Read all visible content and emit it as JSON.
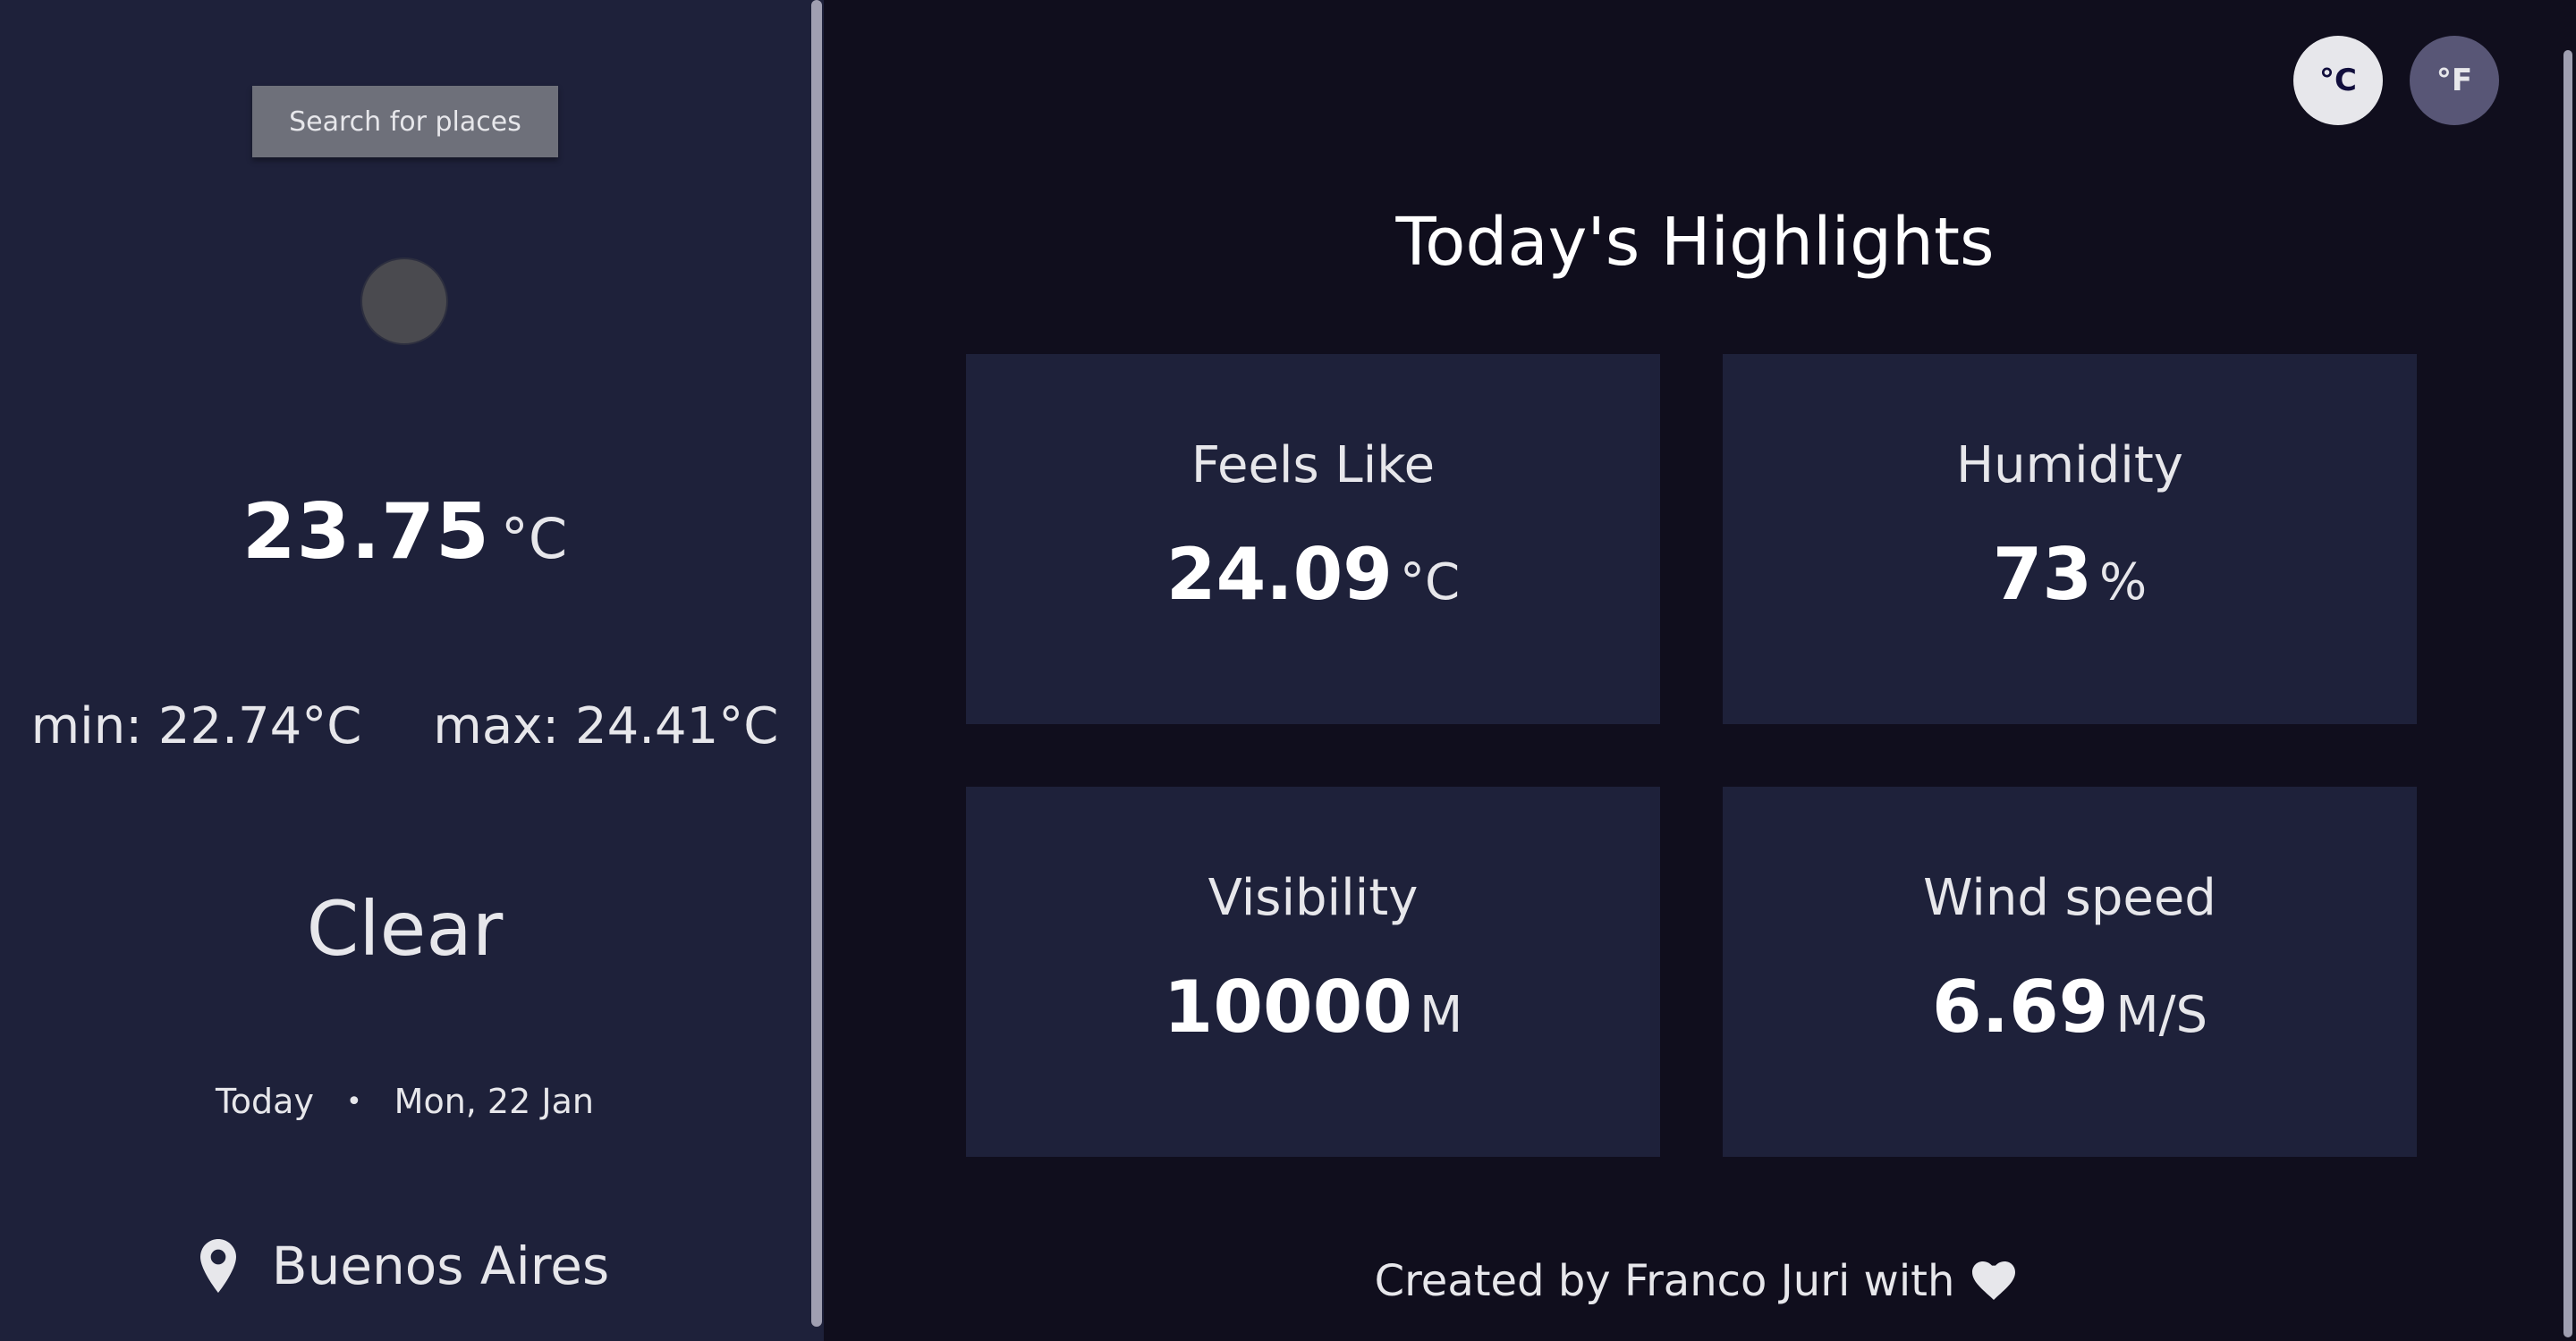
{
  "sidebar": {
    "search_label": "Search for places",
    "current": {
      "temp": "23.75",
      "unit": "°C",
      "min": "min: 22.74°C",
      "max": "max: 24.41°C",
      "condition": "Clear"
    },
    "date": {
      "today": "Today",
      "separator": "•",
      "date": "Mon, 22 Jan"
    },
    "location": "Buenos Aires"
  },
  "units": {
    "celsius": "°C",
    "fahrenheit": "°F"
  },
  "highlights": {
    "title": "Today's Highlights",
    "cards": [
      {
        "title": "Feels Like",
        "value": "24.09",
        "unit": "°C"
      },
      {
        "title": "Humidity",
        "value": "73",
        "unit": "%"
      },
      {
        "title": "Visibility",
        "value": "10000",
        "unit": "M"
      },
      {
        "title": "Wind speed",
        "value": "6.69",
        "unit": "M/S"
      }
    ]
  },
  "footer": {
    "text": "Created by Franco Juri with"
  },
  "colors": {
    "background": "#100e1d",
    "sidebar": "#1e213a",
    "card": "#1e213a",
    "search_button": "#6e707a",
    "unit_active": "#e7e7eb",
    "unit_inactive": "#585676"
  },
  "icons": {
    "weather": "weather-icon",
    "location": "map-pin-icon",
    "footer": "heart-icon"
  }
}
